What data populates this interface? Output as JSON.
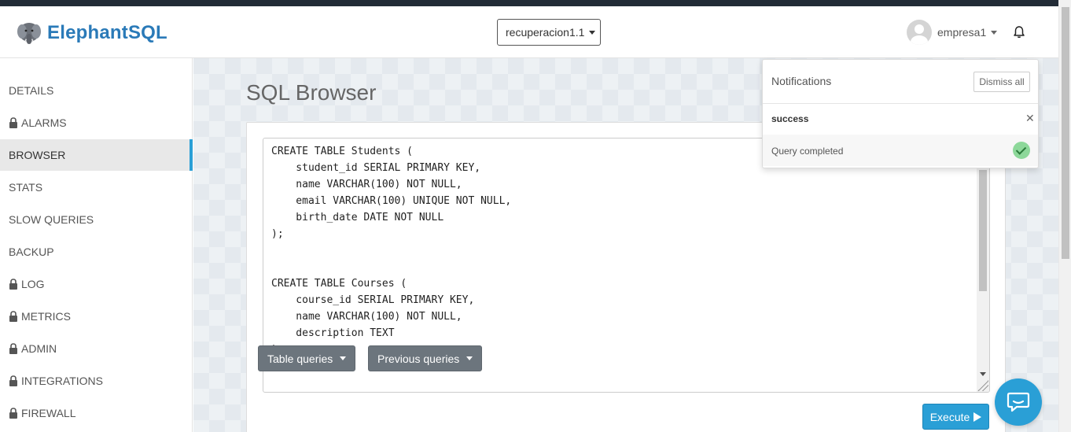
{
  "brand": {
    "name": "ElephantSQL",
    "logo_icon": "elephant-logo-icon"
  },
  "instance_selector": {
    "value": "recuperacion1.1"
  },
  "user": {
    "name": "empresa1"
  },
  "sidebar": {
    "items": [
      {
        "label": "DETAILS",
        "locked": false
      },
      {
        "label": "ALARMS",
        "locked": true
      },
      {
        "label": "BROWSER",
        "locked": false,
        "active": true
      },
      {
        "label": "STATS",
        "locked": false
      },
      {
        "label": "SLOW QUERIES",
        "locked": false
      },
      {
        "label": "BACKUP",
        "locked": false
      },
      {
        "label": "LOG",
        "locked": true
      },
      {
        "label": "METRICS",
        "locked": true
      },
      {
        "label": "ADMIN",
        "locked": true
      },
      {
        "label": "INTEGRATIONS",
        "locked": true
      },
      {
        "label": "FIREWALL",
        "locked": true
      }
    ]
  },
  "main": {
    "title": "SQL Browser",
    "query": "CREATE TABLE Students (\n    student_id SERIAL PRIMARY KEY,\n    name VARCHAR(100) NOT NULL,\n    email VARCHAR(100) UNIQUE NOT NULL,\n    birth_date DATE NOT NULL\n);\n\n\nCREATE TABLE Courses (\n    course_id SERIAL PRIMARY KEY,\n    name VARCHAR(100) NOT NULL,\n    description TEXT\n);",
    "table_queries_label": "Table queries",
    "previous_queries_label": "Previous queries",
    "execute_label": "Execute"
  },
  "notifications": {
    "title": "Notifications",
    "dismiss_label": "Dismiss all",
    "items": [
      {
        "status": "success",
        "message": "Query completed"
      }
    ]
  },
  "colors": {
    "accent": "#2a9fd6",
    "brand": "#2a7ab8",
    "top_strip": "#222b36",
    "success": "#8dd89a"
  }
}
